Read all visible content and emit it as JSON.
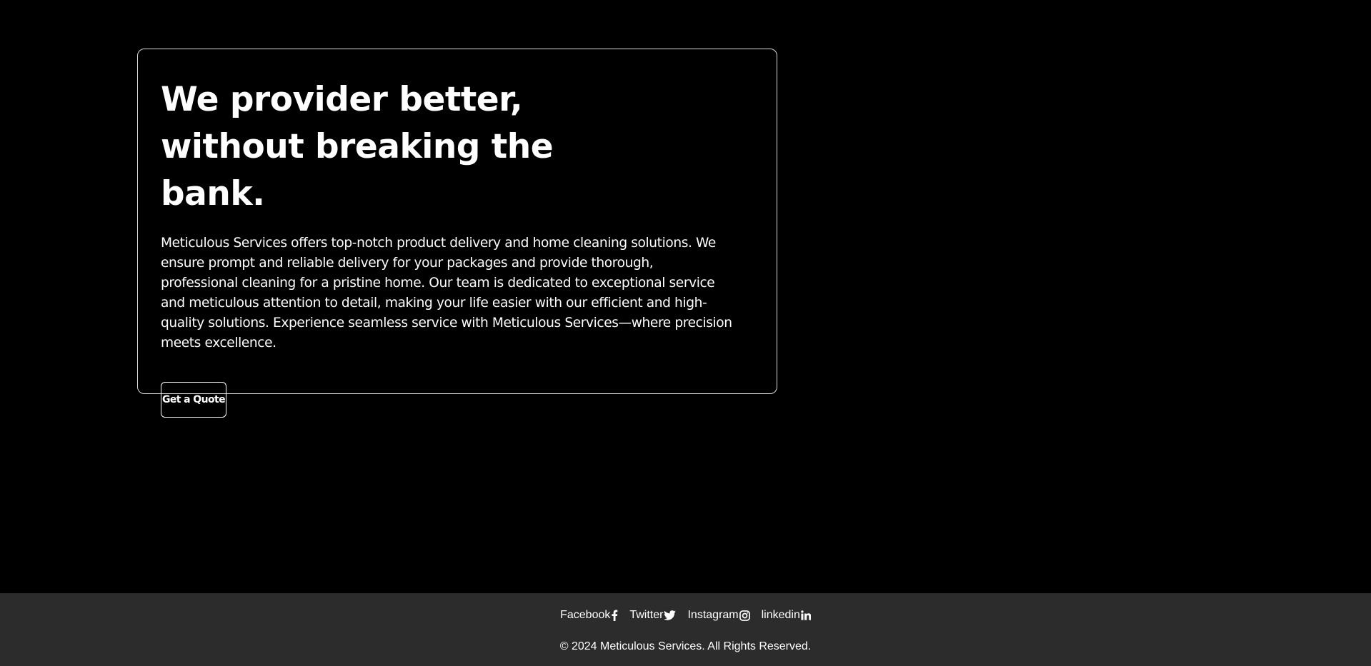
{
  "hero": {
    "title": "We provider better, without breaking the bank.",
    "description": "Meticulous Services offers top-notch product delivery and home cleaning solutions. We ensure prompt and reliable delivery for your packages and provide thorough, professional cleaning for a pristine home. Our team is dedicated to exceptional service and meticulous attention to detail, making your life easier with our efficient and high-quality solutions. Experience seamless service with Meticulous Services—where precision meets excellence.",
    "cta_label": "Get a Quote"
  },
  "footer": {
    "social": [
      {
        "label": "Facebook",
        "icon": "facebook-icon"
      },
      {
        "label": "Twitter",
        "icon": "twitter-icon"
      },
      {
        "label": "Instagram",
        "icon": "instagram-icon"
      },
      {
        "label": "linkedin",
        "icon": "linkedin-icon"
      }
    ],
    "copyright": "© 2024 Meticulous Services. All Rights Reserved."
  },
  "colors": {
    "background": "#000000",
    "footer_background": "#2c2c2c",
    "text": "#ffffff",
    "card_border": "#d9d9d9"
  }
}
